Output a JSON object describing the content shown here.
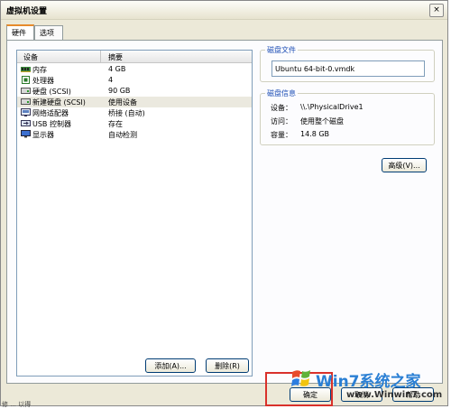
{
  "window": {
    "title": "虚拟机设置",
    "close_glyph": "×"
  },
  "tabs": [
    {
      "label": "硬件"
    },
    {
      "label": "选项"
    }
  ],
  "device_list": {
    "columns": {
      "device": "设备",
      "summary": "摘要"
    },
    "rows": [
      {
        "name": "内存",
        "summary": "4 GB",
        "icon": "memory-icon"
      },
      {
        "name": "处理器",
        "summary": "4",
        "icon": "processor-icon"
      },
      {
        "name": "硬盘 (SCSI)",
        "summary": "90 GB",
        "icon": "harddisk-icon"
      },
      {
        "name": "新建硬盘 (SCSI)",
        "summary": "使用设备",
        "icon": "harddisk-icon",
        "selected": true
      },
      {
        "name": "网络适配器",
        "summary": "桥接 (自动)",
        "icon": "network-adapter-icon"
      },
      {
        "name": "USB 控制器",
        "summary": "存在",
        "icon": "usb-icon"
      },
      {
        "name": "显示器",
        "summary": "自动检测",
        "icon": "display-icon"
      }
    ]
  },
  "list_buttons": {
    "add": "添加(A)...",
    "remove": "删除(R)"
  },
  "disk_file": {
    "group_title": "磁盘文件",
    "value": "Ubuntu 64-bit-0.vmdk"
  },
  "disk_info": {
    "group_title": "磁盘信息",
    "device_label": "设备：",
    "device_value": "\\\\.\\PhysicalDrive1",
    "access_label": "访问：",
    "access_value": "使用整个磁盘",
    "capacity_label": "容量：",
    "capacity_value": "14.8 GB"
  },
  "advanced_button": "高级(V)...",
  "footer_buttons": {
    "ok": "确定",
    "cancel": "取消",
    "help": "帮助"
  },
  "watermark": {
    "brand": "Win7系统之家",
    "url": "www.Winwin7.com"
  },
  "status_text": "修 ... 以得",
  "colors": {
    "accent_tab": "#e68b2c",
    "highlight": "#d9312b",
    "group_title": "#1d4eb5"
  }
}
